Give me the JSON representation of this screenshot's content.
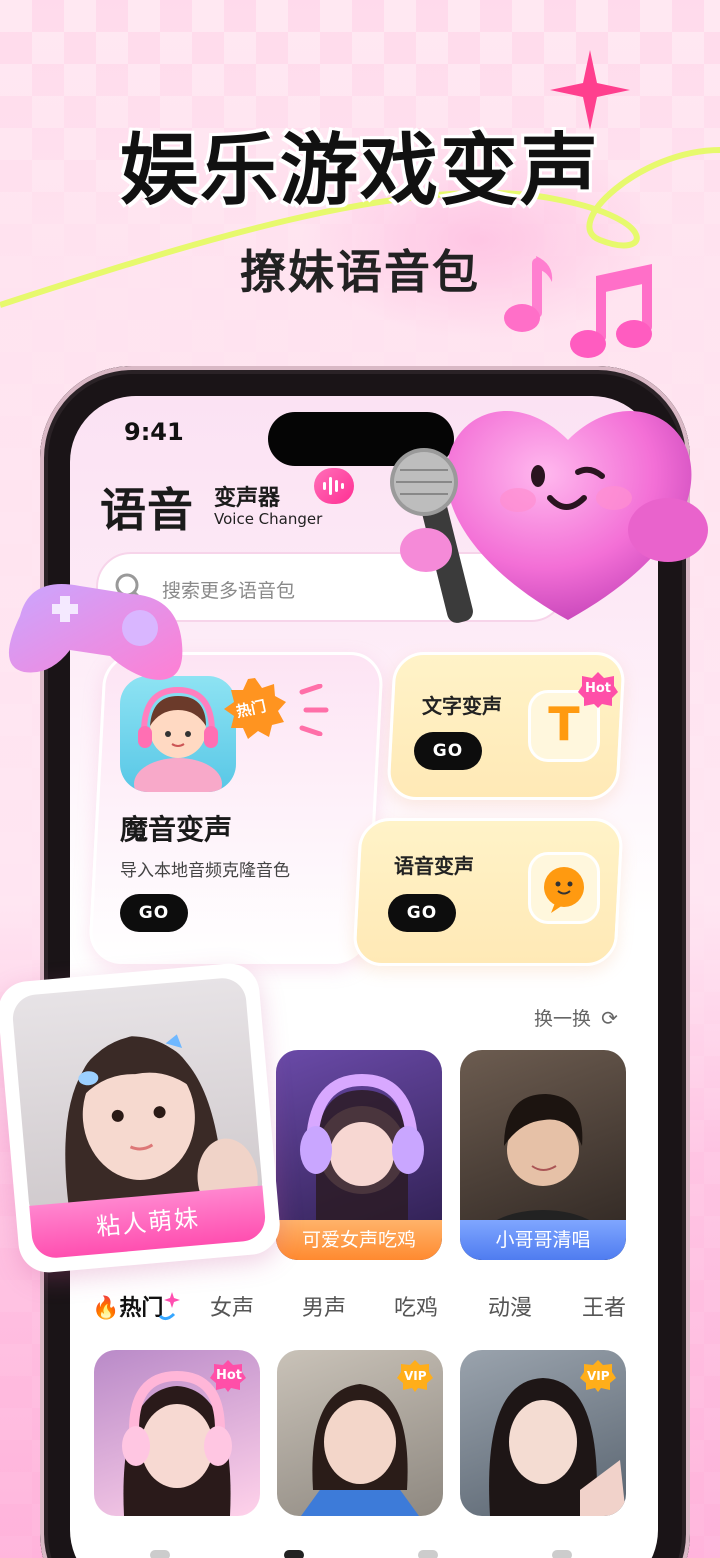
{
  "promo": {
    "headline": "娱乐游戏变声",
    "subline": "撩妹语音包"
  },
  "status_bar": {
    "time": "9:41"
  },
  "app": {
    "logo_cn": "语音",
    "logo_cn_small": "变声器",
    "logo_en": "Voice Changer"
  },
  "search": {
    "placeholder": "搜索更多语音包"
  },
  "features": {
    "magic": {
      "badge": "热门",
      "title": "魔音变声",
      "desc": "导入本地音频克隆音色",
      "go": "GO"
    },
    "text_voice": {
      "title": "文字变声",
      "badge": "Hot",
      "go": "GO",
      "icon": "T"
    },
    "voice_change": {
      "title": "语音变声",
      "go": "GO"
    }
  },
  "recommend": {
    "refresh_label": "换一换",
    "featured": "粘人萌妹",
    "items": [
      {
        "label": "可爱女声吃鸡",
        "color": "#ff9a3c"
      },
      {
        "label": "小哥哥清唱",
        "color": "#5c8cf5"
      }
    ]
  },
  "tabs": {
    "hot": "热门",
    "items": [
      "女声",
      "男声",
      "吃鸡",
      "动漫",
      "王者"
    ]
  },
  "pack_badges": [
    "Hot",
    "VIP",
    "VIP"
  ],
  "colors": {
    "accent_pink": "#ff4fb0",
    "go_button": "#0d0d0d",
    "card_yellow": "#ffe9b6"
  }
}
